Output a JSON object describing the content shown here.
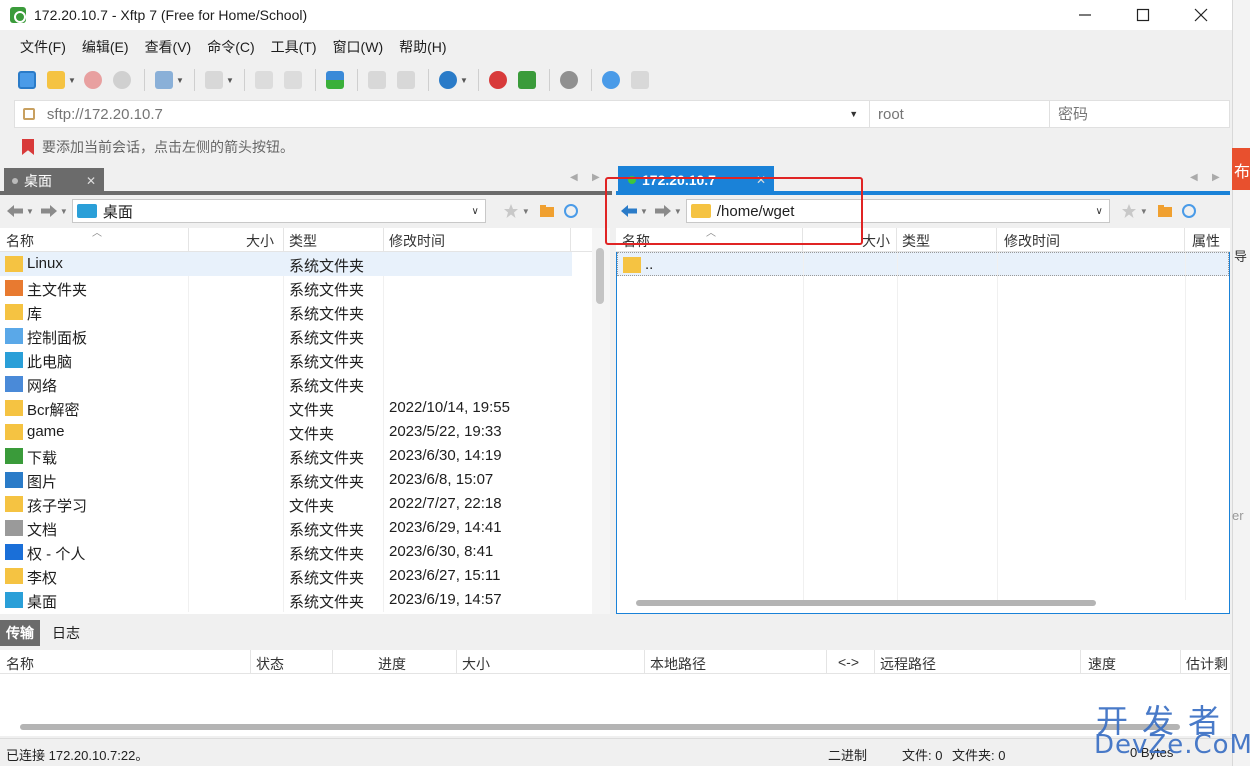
{
  "window": {
    "title": "172.20.10.7 - Xftp 7 (Free for Home/School)"
  },
  "menu": [
    "文件(F)",
    "编辑(E)",
    "查看(V)",
    "命令(C)",
    "工具(T)",
    "窗口(W)",
    "帮助(H)"
  ],
  "address": {
    "url_placeholder": "sftp://172.20.10.7",
    "user_placeholder": "root",
    "password_placeholder": "密码"
  },
  "hint": "要添加当前会话，点击左侧的箭头按钮。",
  "local": {
    "tab_label": "桌面",
    "path": "桌面",
    "columns": [
      "名称",
      "大小",
      "类型",
      "修改时间"
    ],
    "files": [
      {
        "name": "Linux",
        "type": "系统文件夹",
        "modified": "",
        "icon": "folder-icon"
      },
      {
        "name": "主文件夹",
        "type": "系统文件夹",
        "modified": "",
        "icon": "home-icon"
      },
      {
        "name": "库",
        "type": "系统文件夹",
        "modified": "",
        "icon": "library-icon"
      },
      {
        "name": "控制面板",
        "type": "系统文件夹",
        "modified": "",
        "icon": "control-panel-icon"
      },
      {
        "name": "此电脑",
        "type": "系统文件夹",
        "modified": "",
        "icon": "computer-icon"
      },
      {
        "name": "网络",
        "type": "系统文件夹",
        "modified": "",
        "icon": "network-icon"
      },
      {
        "name": "Bcr解密",
        "type": "文件夹",
        "modified": "2022/10/14, 19:55",
        "icon": "folder-icon"
      },
      {
        "name": "game",
        "type": "文件夹",
        "modified": "2023/5/22, 19:33",
        "icon": "folder-icon"
      },
      {
        "name": "下载",
        "type": "系统文件夹",
        "modified": "2023/6/30, 14:19",
        "icon": "download-icon"
      },
      {
        "name": "图片",
        "type": "系统文件夹",
        "modified": "2023/6/8, 15:07",
        "icon": "pictures-icon"
      },
      {
        "name": "孩子学习",
        "type": "文件夹",
        "modified": "2022/7/27, 22:18",
        "icon": "folder-icon"
      },
      {
        "name": "文档",
        "type": "系统文件夹",
        "modified": "2023/6/29, 14:41",
        "icon": "document-icon"
      },
      {
        "name": "权 - 个人",
        "type": "系统文件夹",
        "modified": "2023/6/30, 8:41",
        "icon": "onedrive-icon"
      },
      {
        "name": "李权",
        "type": "系统文件夹",
        "modified": "2023/6/27, 15:11",
        "icon": "folder-icon"
      },
      {
        "name": "桌面",
        "type": "系统文件夹",
        "modified": "2023/6/19, 14:57",
        "icon": "desktop-icon"
      }
    ]
  },
  "remote": {
    "tab_label": "172.20.10.7",
    "path": "/home/wget",
    "columns": [
      "名称",
      "大小",
      "类型",
      "修改时间",
      "属性"
    ],
    "files": [
      {
        "name": "..",
        "icon": "folder-icon"
      }
    ]
  },
  "transfer": {
    "tabs": [
      "传输",
      "日志"
    ],
    "columns": [
      "名称",
      "状态",
      "进度",
      "大小",
      "本地路径",
      "<->",
      "远程路径",
      "速度",
      "估计剩"
    ]
  },
  "status": {
    "connection": "已连接 172.20.10.7:22。",
    "mode": "二进制",
    "files": "文件: 0",
    "folders": "文件夹: 0",
    "size": "0 Bytes"
  },
  "background": {
    "red_tab_char": "布",
    "side_char": "导",
    "side_char2": "er"
  },
  "watermark": {
    "cn": "开发者",
    "en": "DevZe.CoM"
  },
  "colors": {
    "accent": "#1a82d8",
    "highlight": "#e02424",
    "folder": "#f5c342"
  }
}
